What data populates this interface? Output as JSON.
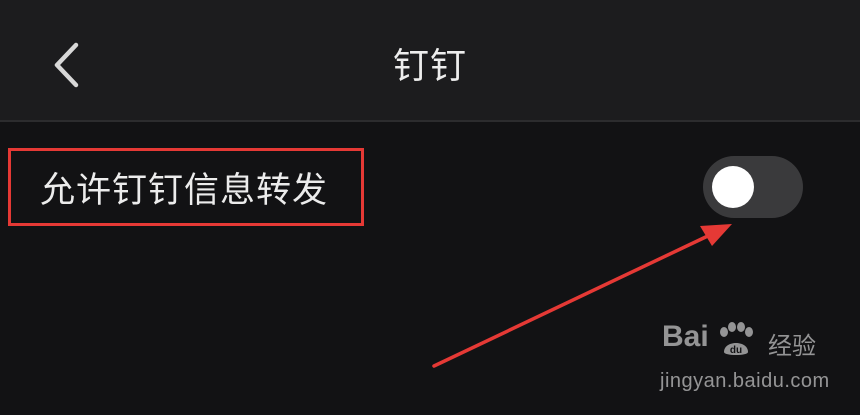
{
  "header": {
    "title": "钉钉",
    "back_icon": "chevron-left-icon"
  },
  "settings": [
    {
      "label": "允许钉钉信息转发",
      "enabled": false
    }
  ],
  "annotations": {
    "highlight_color": "#e53935",
    "arrow_color": "#e53935"
  },
  "watermark": {
    "brand": "Bai",
    "tag": "经验",
    "url": "jingyan.baidu.com"
  }
}
